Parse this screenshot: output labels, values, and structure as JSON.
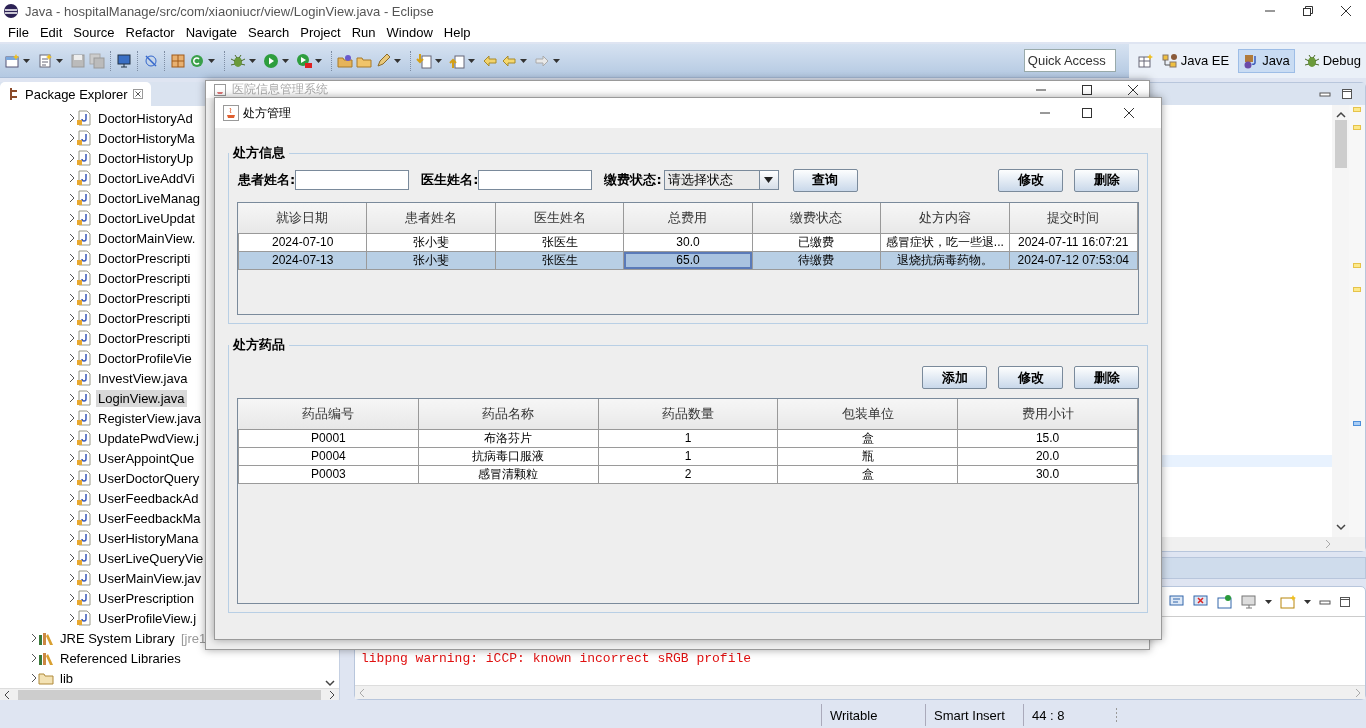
{
  "window": {
    "title": "Java - hospitalManage/src/com/xiaoniucr/view/LoginView.java - Eclipse",
    "menu": [
      "File",
      "Edit",
      "Source",
      "Refactor",
      "Navigate",
      "Search",
      "Project",
      "Run",
      "Window",
      "Help"
    ]
  },
  "toolbar": {
    "quick_access": {
      "placeholder": "Quick Access"
    },
    "perspectives": [
      {
        "label": "Java EE",
        "selected": false,
        "kind": "javaee"
      },
      {
        "label": "Java",
        "selected": true,
        "kind": "java"
      },
      {
        "label": "Debug",
        "selected": false,
        "kind": "debug"
      }
    ]
  },
  "package_explorer": {
    "title": "Package Explorer",
    "files": [
      {
        "label": "DoctorHistoryAd",
        "selected": false
      },
      {
        "label": "DoctorHistoryMa",
        "selected": false
      },
      {
        "label": "DoctorHistoryUp",
        "selected": false
      },
      {
        "label": "DoctorLiveAddVi",
        "selected": false
      },
      {
        "label": "DoctorLiveManag",
        "selected": false
      },
      {
        "label": "DoctorLiveUpdat",
        "selected": false
      },
      {
        "label": "DoctorMainView.",
        "selected": false
      },
      {
        "label": "DoctorPrescripti",
        "selected": false
      },
      {
        "label": "DoctorPrescripti",
        "selected": false
      },
      {
        "label": "DoctorPrescripti",
        "selected": false
      },
      {
        "label": "DoctorPrescripti",
        "selected": false
      },
      {
        "label": "DoctorPrescripti",
        "selected": false
      },
      {
        "label": "DoctorProfileVie",
        "selected": false
      },
      {
        "label": "InvestView.java",
        "selected": false
      },
      {
        "label": "LoginView.java",
        "selected": true
      },
      {
        "label": "RegisterView.java",
        "selected": false
      },
      {
        "label": "UpdatePwdView.j",
        "selected": false
      },
      {
        "label": "UserAppointQue",
        "selected": false
      },
      {
        "label": "UserDoctorQuery",
        "selected": false
      },
      {
        "label": "UserFeedbackAd",
        "selected": false
      },
      {
        "label": "UserFeedbackMa",
        "selected": false
      },
      {
        "label": "UserHistoryMana",
        "selected": false
      },
      {
        "label": "UserLiveQueryVie",
        "selected": false
      },
      {
        "label": "UserMainView.jav",
        "selected": false
      },
      {
        "label": "UserPrescription",
        "selected": false
      },
      {
        "label": "UserProfileView.j",
        "selected": false
      }
    ],
    "project_items": [
      {
        "label": "JRE System Library",
        "suffix": "[jre1",
        "kind": "library"
      },
      {
        "label": "Referenced Libraries",
        "kind": "library"
      },
      {
        "label": "lib",
        "kind": "folder"
      }
    ]
  },
  "console": {
    "lines": [
      {
        "text": "libpng warning: iCCP: known incorrect sRGB profile",
        "kind": "error"
      }
    ]
  },
  "status_bar": [
    "Writable",
    "Smart Insert",
    "44 : 8"
  ],
  "back_dialog": {
    "title": "医院信息管理系统"
  },
  "dialog": {
    "title": "处方管理",
    "prescriptions": {
      "title": "处方信息",
      "filters": [
        {
          "label": "患者姓名:",
          "kind": "text"
        },
        {
          "label": "医生姓名:",
          "kind": "text"
        },
        {
          "label": "缴费状态:",
          "kind": "combo",
          "value": "请选择状态"
        }
      ],
      "search_button": "查询",
      "actions": [
        "修改",
        "删除"
      ],
      "columns": [
        "就诊日期",
        "患者姓名",
        "医生姓名",
        "总费用",
        "缴费状态",
        "处方内容",
        "提交时间"
      ],
      "rows": [
        {
          "selected": false,
          "cells": [
            {
              "text": "2024-07-10",
              "focused": false
            },
            {
              "text": "张小斐",
              "focused": false
            },
            {
              "text": "张医生",
              "focused": false
            },
            {
              "text": "30.0",
              "focused": false
            },
            {
              "text": "已缴费",
              "focused": false
            },
            {
              "text": "感冒症状，吃一些退...",
              "focused": false
            },
            {
              "text": "2024-07-11 16:07:21",
              "focused": false
            }
          ]
        },
        {
          "selected": true,
          "cells": [
            {
              "text": "2024-07-13",
              "focused": false
            },
            {
              "text": "张小斐",
              "focused": false
            },
            {
              "text": "张医生",
              "focused": false
            },
            {
              "text": "65.0",
              "focused": true
            },
            {
              "text": "待缴费",
              "focused": false
            },
            {
              "text": "退烧抗病毒药物。",
              "focused": false
            },
            {
              "text": "2024-07-12 07:53:04",
              "focused": false
            }
          ]
        }
      ]
    },
    "medicines": {
      "title": "处方药品",
      "actions": [
        "添加",
        "修改",
        "删除"
      ],
      "columns": [
        "药品编号",
        "药品名称",
        "药品数量",
        "包装单位",
        "费用小计"
      ],
      "rows": [
        [
          "P0001",
          "布洛芬片",
          "1",
          "盒",
          "15.0"
        ],
        [
          "P0004",
          "抗病毒口服液",
          "1",
          "瓶",
          "20.0"
        ],
        [
          "P0003",
          "感冒清颗粒",
          "2",
          "盒",
          "30.0"
        ]
      ]
    }
  }
}
